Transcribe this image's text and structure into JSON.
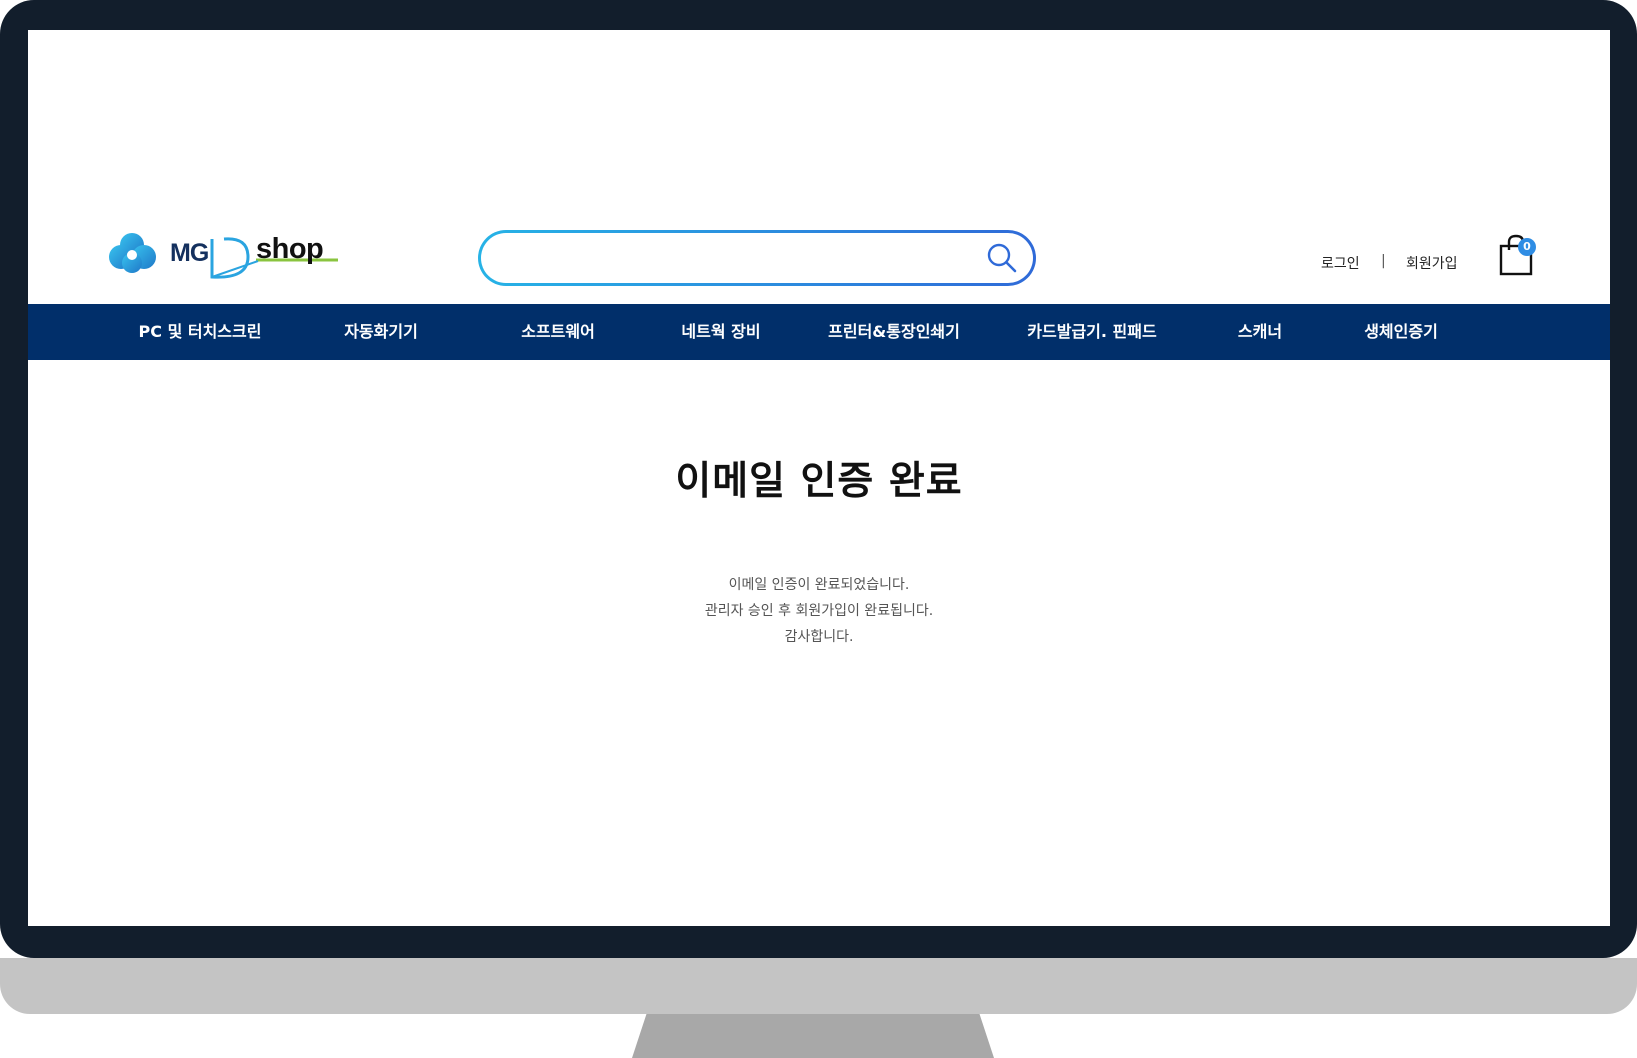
{
  "header": {
    "logo_left": "MG",
    "logo_right": "shop",
    "search_placeholder": "",
    "search_icon": "search-icon",
    "login": "로그인",
    "separator": "|",
    "signup": "회원가입",
    "cart_icon": "shopping-bag-icon",
    "cart_count": "0"
  },
  "nav": {
    "items": [
      "PC 및 터치스크린",
      "자동화기기",
      "소프트웨어",
      "네트웍 장비",
      "프린터&통장인쇄기",
      "카드발급기. 핀패드",
      "스캐너",
      "생체인증기"
    ]
  },
  "main": {
    "title": "이메일 인증 완료",
    "lines": [
      "이메일 인증이 완료되었습니다.",
      "관리자 승인 후 회원가입이 완료됩니다.",
      "감사합니다."
    ]
  },
  "colors": {
    "nav_bg": "#012f6a",
    "search_gradient_start": "#27b3e6",
    "search_gradient_end": "#2f6ad8",
    "cart_badge": "#2f8de4",
    "logo_accent": "#2aa4e0",
    "logo_underline": "#8ac43f"
  }
}
